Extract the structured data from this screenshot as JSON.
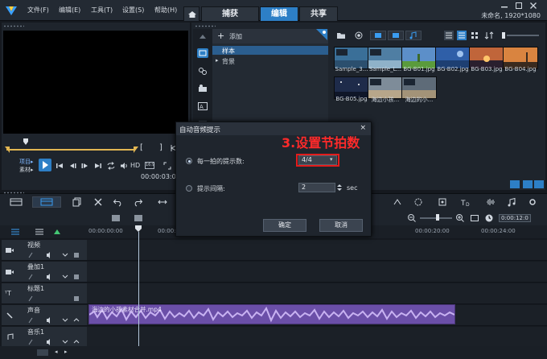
{
  "menu": {
    "items": [
      {
        "label": "文件(F)"
      },
      {
        "label": "编辑(E)"
      },
      {
        "label": "工具(T)"
      },
      {
        "label": "设置(S)"
      },
      {
        "label": "帮助(H)"
      }
    ]
  },
  "tabs": {
    "capture": "捕获",
    "edit": "编辑",
    "share": "共享",
    "active": "edit"
  },
  "window": {
    "info": "未命名, 1920*1080"
  },
  "preview": {
    "mode_project": "项目▸",
    "mode_clip": "素材▸",
    "hd": "HD",
    "timecode": "00:00:03:00",
    "scrub_position": 0.14
  },
  "library": {
    "add_label": "添加",
    "tree": [
      "样本",
      "背景"
    ],
    "thumbnails": [
      {
        "label": "Sample_3...",
        "color": "#3a6f98"
      },
      {
        "label": "Sample_L...",
        "color": "#4f7ea3"
      },
      {
        "label": "BG-B01.jpg",
        "color": "#5c8fc9"
      },
      {
        "label": "BG-B02.jpg",
        "color": "#2f5fa8"
      },
      {
        "label": "BG-B03.jpg",
        "color": "#c0653a"
      },
      {
        "label": "BG-B04.jpg",
        "color": "#d98440"
      },
      {
        "label": "BG-B05.jpg",
        "color": "#1e2b4a"
      },
      {
        "label": "海边小孩...",
        "color": "#7e8c99"
      },
      {
        "label": "海边的小...",
        "color": "#5e6b78"
      }
    ]
  },
  "timeline": {
    "ruler": [
      "00:00:00:00",
      "00:00:04",
      "00:00:20:00",
      "00:00:24:00"
    ],
    "zoom_time": "0:00:12:0",
    "tracks": [
      {
        "name": "视频"
      },
      {
        "name": "叠加1"
      },
      {
        "name": "标题1"
      },
      {
        "name": "声音"
      },
      {
        "name": "音乐1"
      }
    ],
    "audio_clip_label": "海边的小孩素材合并.mp4"
  },
  "dialog": {
    "title": "自动音频提示",
    "close": "×",
    "option1_label": "每一拍的提示数:",
    "option1_value": "4/4",
    "option2_label": "提示间隔:",
    "option2_value": "2",
    "option2_unit": "sec",
    "ok": "确定",
    "cancel": "取消"
  },
  "annotation": {
    "text": "3.设置节拍数",
    "color": "#e31c1c"
  }
}
